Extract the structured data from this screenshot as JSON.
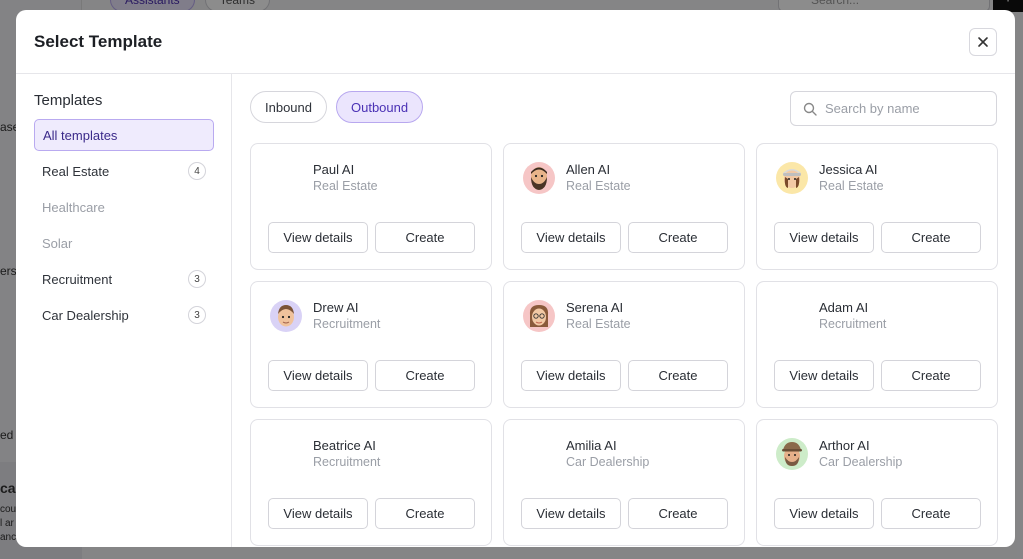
{
  "background": {
    "tabs": [
      "Assistants",
      "Teams"
    ],
    "search_placeholder": "Search...",
    "fragments": [
      "ase",
      "ers",
      "ed",
      "cad",
      "cou",
      "l ar",
      "anc"
    ]
  },
  "modal": {
    "title": "Select Template"
  },
  "sidebar": {
    "title": "Templates",
    "items": [
      {
        "label": "All templates",
        "count": "",
        "state": "active"
      },
      {
        "label": "Real Estate",
        "count": "4",
        "state": "normal"
      },
      {
        "label": "Healthcare",
        "count": "",
        "state": "disabled"
      },
      {
        "label": "Solar",
        "count": "",
        "state": "disabled"
      },
      {
        "label": "Recruitment",
        "count": "3",
        "state": "normal"
      },
      {
        "label": "Car Dealership",
        "count": "3",
        "state": "normal"
      }
    ]
  },
  "filters": [
    {
      "label": "Inbound",
      "active": false
    },
    {
      "label": "Outbound",
      "active": true
    }
  ],
  "search": {
    "placeholder": "Search by name",
    "value": ""
  },
  "buttons": {
    "view_details": "View details",
    "create": "Create"
  },
  "templates": [
    {
      "name": "Paul AI",
      "category": "Real Estate",
      "avatar": "none",
      "avatar_bg": ""
    },
    {
      "name": "Allen AI",
      "category": "Real Estate",
      "avatar": "bearded-man-avatar",
      "avatar_bg": "#f6c6c6"
    },
    {
      "name": "Jessica AI",
      "category": "Real Estate",
      "avatar": "woman-cap-avatar",
      "avatar_bg": "#fbe7a8"
    },
    {
      "name": "Drew AI",
      "category": "Recruitment",
      "avatar": "man-avatar",
      "avatar_bg": "#d9d2f6"
    },
    {
      "name": "Serena AI",
      "category": "Real Estate",
      "avatar": "woman-glasses-avatar",
      "avatar_bg": "#f6c6c6"
    },
    {
      "name": "Adam AI",
      "category": "Recruitment",
      "avatar": "none",
      "avatar_bg": ""
    },
    {
      "name": "Beatrice AI",
      "category": "Recruitment",
      "avatar": "none",
      "avatar_bg": ""
    },
    {
      "name": "Amilia AI",
      "category": "Car Dealership",
      "avatar": "none",
      "avatar_bg": ""
    },
    {
      "name": "Arthor AI",
      "category": "Car Dealership",
      "avatar": "man-hat-avatar",
      "avatar_bg": "#cdecc9"
    }
  ]
}
